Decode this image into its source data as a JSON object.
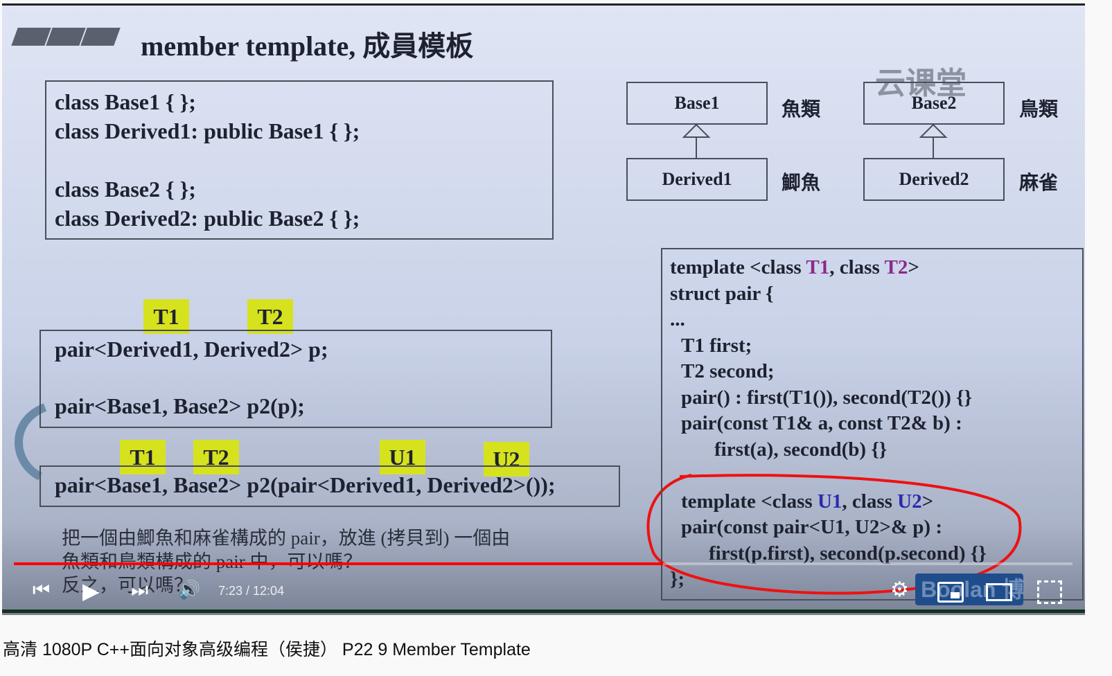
{
  "slide": {
    "title": "member template, 成員模板",
    "watermark": "云课堂",
    "code_top": [
      "class Base1 { };",
      "class Derived1: public Base1 { };",
      "",
      "class Base2 { };",
      "class Derived2: public Base2 { };"
    ],
    "uml": {
      "base1": "Base1",
      "derived1": "Derived1",
      "base2": "Base2",
      "derived2": "Derived2",
      "base1_label": "魚類",
      "derived1_label": "鯽魚",
      "base2_label": "鳥類",
      "derived2_label": "麻雀"
    },
    "tags": {
      "t1": "T1",
      "t2": "T2",
      "u1": "U1",
      "u2": "U2"
    },
    "code_mid": [
      "pair<Derived1, Derived2> p;",
      "pair<Base1, Base2> p2(p);"
    ],
    "code_bottom": "pair<Base1, Base2> p2(pair<Derived1, Derived2>());",
    "note": [
      "把一個由鯽魚和麻雀構成的 pair，放進 (拷貝到) 一個由",
      "魚類和鳥類構成的 pair 中，可以嗎？",
      "反之，可以嗎？"
    ],
    "code_right": {
      "l1a": "template <class ",
      "l1b": "T1",
      "l1c": ", class ",
      "l1d": "T2",
      "l1e": ">",
      "l2": "struct pair {",
      "l3": "...",
      "l4": "T1 first;",
      "l5": "T2 second;",
      "l6": "pair() : first(T1()), second(T2()) {}",
      "l7": "pair(const T1& a, const T2& b) :",
      "l8": "first(a), second(b) {}",
      "l9a": "template <class ",
      "l9b": "U1",
      "l9c": ", class ",
      "l9d": "U2",
      "l9e": ">",
      "l10": "pair(const pair<U1, U2>& p) :",
      "l11": "first(p.first), second(p.second) {}",
      "l12": "};"
    },
    "logo": "Boolan 博览"
  },
  "player": {
    "time": "7:23 / 12:04",
    "progress": 0.613,
    "accent": "#ff0000"
  },
  "video_title": "高清 1080P C++面向对象高级编程（侯捷） P22 9 Member Template"
}
